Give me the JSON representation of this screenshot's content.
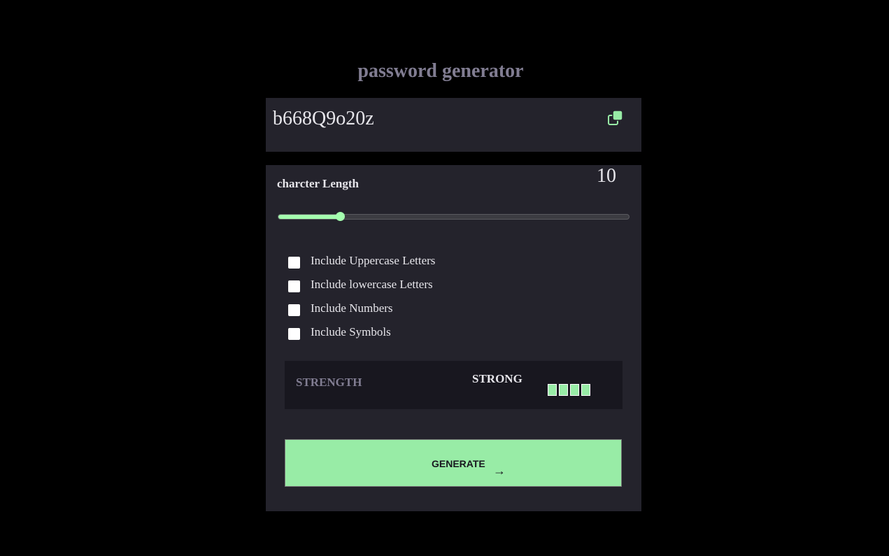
{
  "app": {
    "title": "password generator"
  },
  "password": {
    "value": "b668Q9o20z",
    "copy_icon": "copy-icon"
  },
  "length": {
    "label": "charcter Length",
    "value": "10",
    "slider_fraction": 0.175
  },
  "options": [
    {
      "label": "Include Uppercase Letters",
      "checked": false
    },
    {
      "label": "Include lowercase Letters",
      "checked": false
    },
    {
      "label": "Include Numbers",
      "checked": false
    },
    {
      "label": "Include Symbols",
      "checked": false
    }
  ],
  "strength": {
    "label": "STRENGTH",
    "value": "STRONG",
    "bars_filled": 4,
    "bars_total": 4,
    "bar_color": "#98eca6"
  },
  "generate": {
    "label": "GENERATE",
    "icon": "arrow-right-icon"
  },
  "colors": {
    "accent": "#a4ffaf",
    "panel": "#24232c",
    "background": "#000000"
  }
}
